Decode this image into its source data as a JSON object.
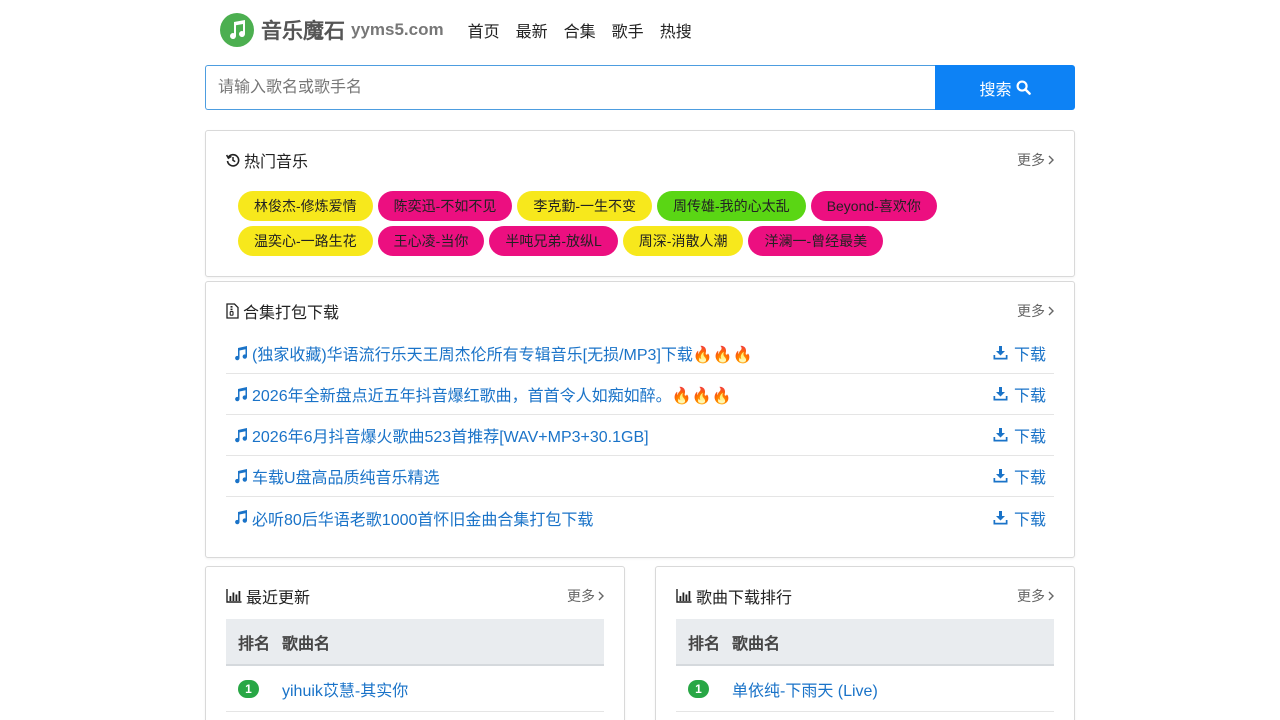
{
  "header": {
    "brand": "音乐魔石",
    "domain": "yyms5.com",
    "nav": [
      "首页",
      "最新",
      "合集",
      "歌手",
      "热搜"
    ]
  },
  "search": {
    "placeholder": "请输入歌名或歌手名",
    "button_label": "搜索"
  },
  "colors": {
    "accent": "#0d82f5",
    "link": "#1a73c8",
    "logo": "#4caf50",
    "rank_badge": "#28a745",
    "tag_yellow": "#f7e81c",
    "tag_pink": "#ec0f80",
    "tag_green": "#5ad614"
  },
  "hot": {
    "title": "热门音乐",
    "more": "更多",
    "tags": [
      {
        "label": "林俊杰-修炼爱情",
        "color": "#f7e81c"
      },
      {
        "label": "陈奕迅-不如不见",
        "color": "#ec0f80"
      },
      {
        "label": "李克勤-一生不变",
        "color": "#f7e81c"
      },
      {
        "label": "周传雄-我的心太乱",
        "color": "#5ad614"
      },
      {
        "label": "Beyond-喜欢你",
        "color": "#ec0f80"
      },
      {
        "label": "温奕心-一路生花",
        "color": "#f7e81c"
      },
      {
        "label": "王心凌-当你",
        "color": "#ec0f80"
      },
      {
        "label": "半吨兄弟-放纵L",
        "color": "#ec0f80"
      },
      {
        "label": "周深-消散人潮",
        "color": "#f7e81c"
      },
      {
        "label": "洋澜一-曾经最美",
        "color": "#ec0f80"
      }
    ]
  },
  "packs": {
    "title": "合集打包下载",
    "more": "更多",
    "download_label": "下载",
    "items": [
      "(独家收藏)华语流行乐天王周杰伦所有专辑音乐[无损/MP3]下载🔥🔥🔥",
      "2026年全新盘点近五年抖音爆红歌曲，首首令人如痴如醉。🔥🔥🔥",
      "2026年6月抖音爆火歌曲523首推荐[WAV+MP3+30.1GB]",
      "车载U盘高品质纯音乐精选",
      "必听80后华语老歌1000首怀旧金曲合集打包下载"
    ]
  },
  "recent": {
    "title": "最近更新",
    "more": "更多",
    "col_rank": "排名",
    "col_song": "歌曲名",
    "rows": [
      {
        "rank": "1",
        "song": "yihuik苡慧-其实你"
      }
    ]
  },
  "ranking": {
    "title": "歌曲下载排行",
    "more": "更多",
    "col_rank": "排名",
    "col_song": "歌曲名",
    "rows": [
      {
        "rank": "1",
        "song": "单依纯-下雨天 (Live)"
      }
    ]
  }
}
